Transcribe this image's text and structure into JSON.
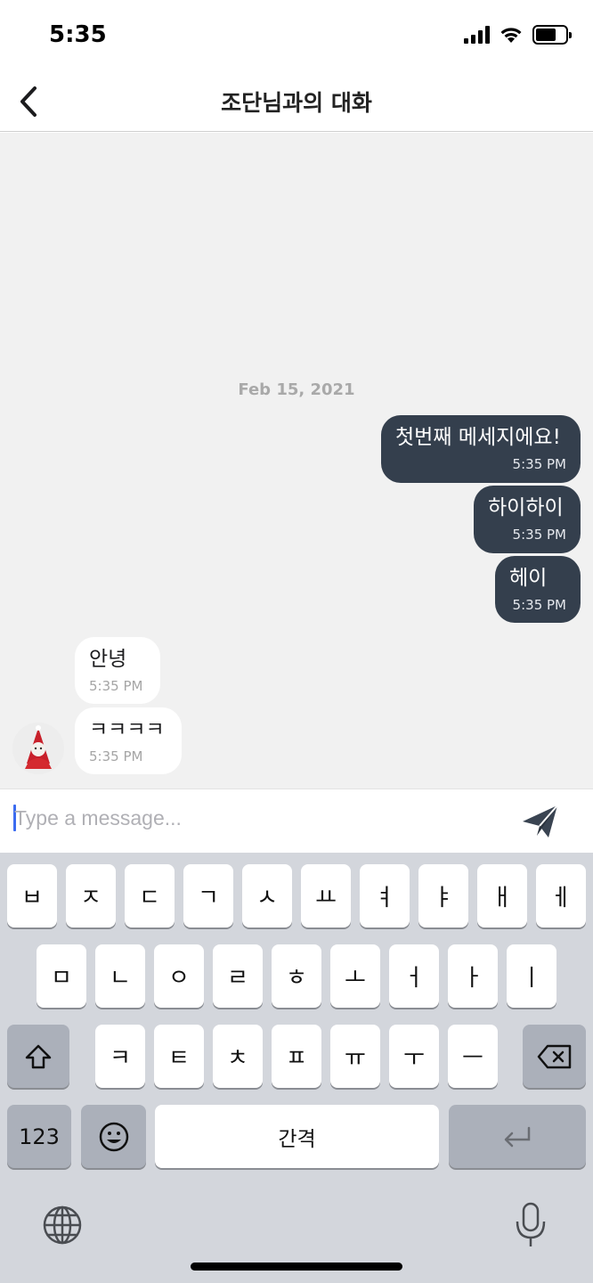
{
  "status_bar": {
    "time": "5:35"
  },
  "header": {
    "title": "조단님과의 대화"
  },
  "chat": {
    "date_separator": "Feb 15, 2021",
    "messages": [
      {
        "direction": "outgoing",
        "text": "첫번째 메세지에요!",
        "time": "5:35 PM"
      },
      {
        "direction": "outgoing",
        "text": "하이하이",
        "time": "5:35 PM"
      },
      {
        "direction": "outgoing",
        "text": "헤이",
        "time": "5:35 PM"
      },
      {
        "direction": "incoming",
        "text": "안녕",
        "time": "5:35 PM"
      },
      {
        "direction": "incoming",
        "text": "ㅋㅋㅋㅋ",
        "time": "5:35 PM"
      }
    ]
  },
  "composer": {
    "placeholder": "Type a message...",
    "value": ""
  },
  "keyboard": {
    "row1": [
      "ㅂ",
      "ㅈ",
      "ㄷ",
      "ㄱ",
      "ㅅ",
      "ㅛ",
      "ㅕ",
      "ㅑ",
      "ㅐ",
      "ㅔ"
    ],
    "row2": [
      "ㅁ",
      "ㄴ",
      "ㅇ",
      "ㄹ",
      "ㅎ",
      "ㅗ",
      "ㅓ",
      "ㅏ",
      "ㅣ"
    ],
    "row3": [
      "ㅋ",
      "ㅌ",
      "ㅊ",
      "ㅍ",
      "ㅠ",
      "ㅜ",
      "ㅡ"
    ],
    "numbers_label": "123",
    "space_label": "간격"
  },
  "colors": {
    "outgoing_bubble": "#343f4d",
    "incoming_bubble": "#ffffff",
    "chat_background": "#f1f1f1",
    "keyboard_background": "#d3d6dc",
    "accent_cursor": "#3b6bf0"
  }
}
